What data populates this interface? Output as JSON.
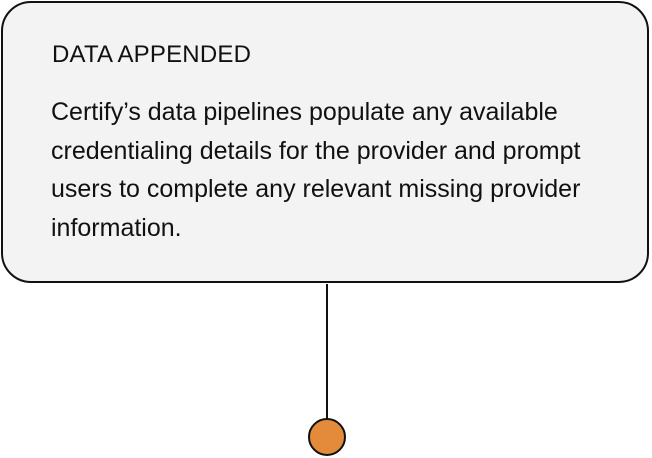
{
  "card": {
    "title": "DATA APPENDED",
    "body": "Certify’s data pipelines populate any available credentialing details for the provider and prompt users to complete any relevant missing provider information."
  },
  "colors": {
    "card_background": "#f3f3f3",
    "border": "#111111",
    "node_fill": "#e38b3a"
  }
}
